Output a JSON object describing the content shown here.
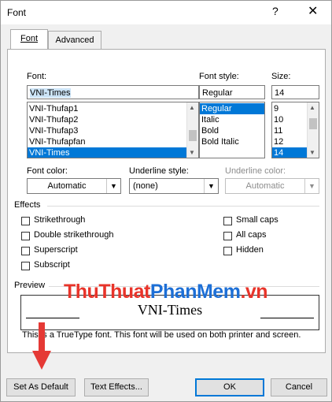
{
  "window": {
    "title": "Font",
    "help": "?",
    "close": "✕"
  },
  "tabs": [
    {
      "label": "Font"
    },
    {
      "label": "Advanced"
    }
  ],
  "font": {
    "label": "Font:",
    "value": "VNI-Times",
    "items": [
      "VNI-Thufap1",
      "VNI-Thufap2",
      "VNI-Thufap3",
      "VNI-Thufapfan",
      "VNI-Times"
    ],
    "selected_index": 4
  },
  "font_style": {
    "label": "Font style:",
    "value": "Regular",
    "items": [
      "Regular",
      "Italic",
      "Bold",
      "Bold Italic"
    ],
    "selected_index": 0
  },
  "size": {
    "label": "Size:",
    "value": "14",
    "items": [
      "9",
      "10",
      "11",
      "12",
      "14"
    ],
    "selected_index": 4
  },
  "font_color": {
    "label": "Font color:",
    "value": "Automatic"
  },
  "underline_style": {
    "label": "Underline style:",
    "value": "(none)"
  },
  "underline_color": {
    "label": "Underline color:",
    "value": "Automatic"
  },
  "effects": {
    "title": "Effects",
    "left": [
      "Strikethrough",
      "Double strikethrough",
      "Superscript",
      "Subscript"
    ],
    "right": [
      "Small caps",
      "All caps",
      "Hidden"
    ]
  },
  "preview": {
    "title": "Preview",
    "sample": "VNI-Times"
  },
  "note": "This is a TrueType font. This font will be used on both printer and screen.",
  "watermark": {
    "part1": "ThuThuat",
    "part2": "PhanMem",
    "part3": ".vn"
  },
  "buttons": {
    "set_default": "Set As Default",
    "text_effects": "Text Effects...",
    "ok": "OK",
    "cancel": "Cancel"
  },
  "colors": {
    "selection": "#0078d7",
    "arrow": "#e53935",
    "wm_red": "#e8342a",
    "wm_blue": "#1d6fd6"
  },
  "icons": {
    "dropdown": "chevron-down-icon",
    "arrow": "red-down-arrow"
  }
}
